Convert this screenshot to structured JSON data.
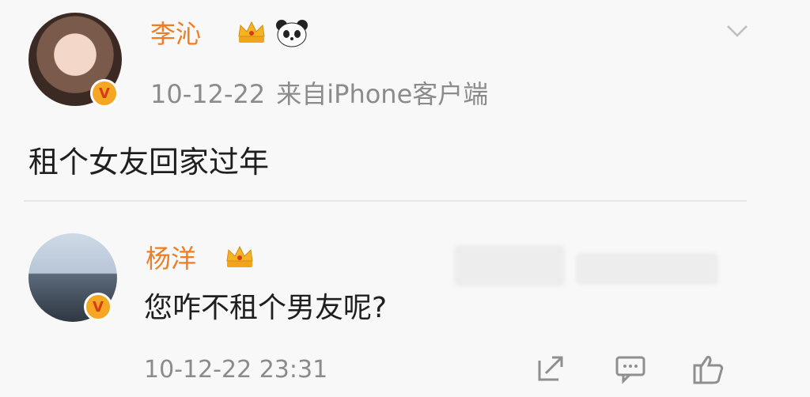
{
  "post": {
    "author": "李沁",
    "date": "10-12-22",
    "source": "来自iPhone客户端",
    "content": "租个女友回家过年"
  },
  "reply": {
    "author": "杨洋",
    "content": "您咋不租个男友呢?",
    "time": "10-12-22 23:31"
  },
  "icons": {
    "crown": "crown-icon",
    "panda": "panda-icon",
    "verified": "verified-v-icon",
    "chevron": "chevron-down-icon",
    "share": "share-icon",
    "comment": "comment-icon",
    "like": "like-icon"
  },
  "badges": {
    "verified_letter": "V"
  },
  "colors": {
    "name": "#f07d23",
    "meta": "#8b8b8b",
    "text": "#1f1f1f",
    "divider": "#e6e6e6"
  }
}
